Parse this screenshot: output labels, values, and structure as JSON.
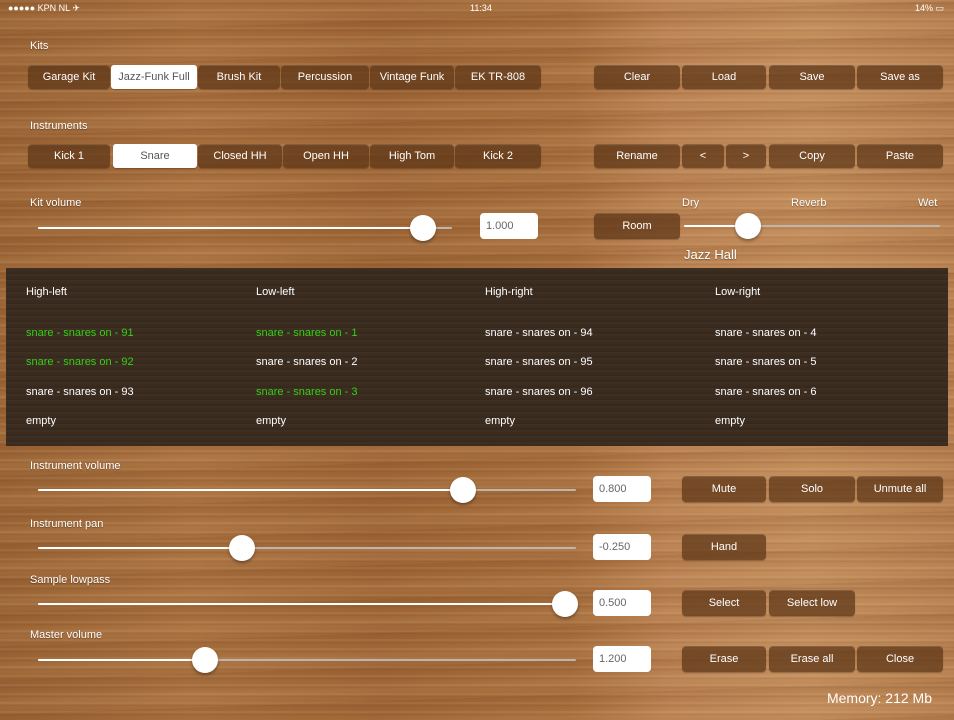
{
  "status": {
    "carrier": "●●●●● KPN NL ✈",
    "time": "11:34",
    "battery": "14% ▭"
  },
  "kits": {
    "label": "Kits",
    "items": [
      "Garage Kit",
      "Jazz-Funk Full",
      "Brush Kit",
      "Percussion",
      "Vintage Funk",
      "EK TR-808"
    ],
    "selected": "Jazz-Funk Full",
    "actions": [
      "Clear",
      "Load",
      "Save",
      "Save as"
    ]
  },
  "instruments": {
    "label": "Instruments",
    "items": [
      "Kick 1",
      "Snare",
      "Closed HH",
      "Open HH",
      "High Tom",
      "Kick 2"
    ],
    "selected": "Snare",
    "actions": [
      "Rename",
      "<",
      ">",
      "Copy",
      "Paste"
    ]
  },
  "kit_volume": {
    "label": "Kit volume",
    "value": "1.000",
    "level": 0.93
  },
  "reverb": {
    "room_label": "Room",
    "dry": "Dry",
    "label": "Reverb",
    "wet": "Wet",
    "preset": "Jazz Hall",
    "level": 0.25
  },
  "samples": {
    "headers": [
      "High-left",
      "Low-left",
      "High-right",
      "Low-right"
    ],
    "columns": [
      [
        {
          "text": "snare - snares on - 91",
          "active": true
        },
        {
          "text": "snare - snares on - 92",
          "active": true
        },
        {
          "text": "snare - snares on - 93",
          "active": false
        },
        {
          "text": "empty",
          "active": false
        }
      ],
      [
        {
          "text": "snare - snares on - 1",
          "active": true
        },
        {
          "text": "snare - snares on - 2",
          "active": false
        },
        {
          "text": "snare - snares on - 3",
          "active": true
        },
        {
          "text": "empty",
          "active": false
        }
      ],
      [
        {
          "text": "snare - snares on - 94",
          "active": false
        },
        {
          "text": "snare - snares on - 95",
          "active": false
        },
        {
          "text": "snare - snares on - 96",
          "active": false
        },
        {
          "text": "empty",
          "active": false
        }
      ],
      [
        {
          "text": "snare - snares on - 4",
          "active": false
        },
        {
          "text": "snare - snares on - 5",
          "active": false
        },
        {
          "text": "snare - snares on - 6",
          "active": false
        },
        {
          "text": "empty",
          "active": false
        }
      ]
    ]
  },
  "instrument_volume": {
    "label": "Instrument volume",
    "value": "0.800",
    "level": 0.79
  },
  "instrument_pan": {
    "label": "Instrument pan",
    "value": "-0.250",
    "level": 0.38
  },
  "sample_lowpass": {
    "label": "Sample lowpass",
    "value": "0.500",
    "level": 0.98
  },
  "master_volume": {
    "label": "Master volume",
    "value": "1.200",
    "level": 0.31
  },
  "buttons": {
    "mute": "Mute",
    "solo": "Solo",
    "unmute_all": "Unmute all",
    "hand": "Hand",
    "select": "Select",
    "select_low": "Select low",
    "erase": "Erase",
    "erase_all": "Erase all",
    "close": "Close"
  },
  "memory": "Memory:  212 Mb"
}
